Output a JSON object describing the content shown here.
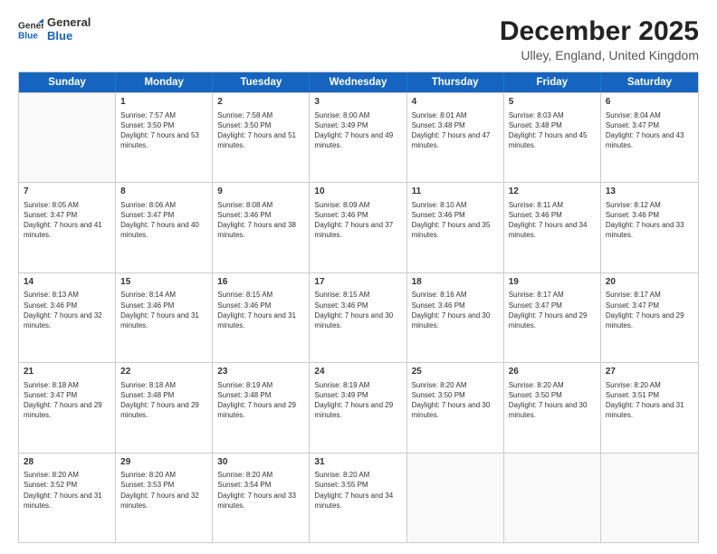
{
  "logo": {
    "line1": "General",
    "line2": "Blue"
  },
  "title": "December 2025",
  "subtitle": "Ulley, England, United Kingdom",
  "days_of_week": [
    "Sunday",
    "Monday",
    "Tuesday",
    "Wednesday",
    "Thursday",
    "Friday",
    "Saturday"
  ],
  "weeks": [
    [
      {
        "day": "",
        "sunrise": "",
        "sunset": "",
        "daylight": "",
        "empty": true
      },
      {
        "day": "1",
        "sunrise": "Sunrise: 7:57 AM",
        "sunset": "Sunset: 3:50 PM",
        "daylight": "Daylight: 7 hours and 53 minutes."
      },
      {
        "day": "2",
        "sunrise": "Sunrise: 7:58 AM",
        "sunset": "Sunset: 3:50 PM",
        "daylight": "Daylight: 7 hours and 51 minutes."
      },
      {
        "day": "3",
        "sunrise": "Sunrise: 8:00 AM",
        "sunset": "Sunset: 3:49 PM",
        "daylight": "Daylight: 7 hours and 49 minutes."
      },
      {
        "day": "4",
        "sunrise": "Sunrise: 8:01 AM",
        "sunset": "Sunset: 3:48 PM",
        "daylight": "Daylight: 7 hours and 47 minutes."
      },
      {
        "day": "5",
        "sunrise": "Sunrise: 8:03 AM",
        "sunset": "Sunset: 3:48 PM",
        "daylight": "Daylight: 7 hours and 45 minutes."
      },
      {
        "day": "6",
        "sunrise": "Sunrise: 8:04 AM",
        "sunset": "Sunset: 3:47 PM",
        "daylight": "Daylight: 7 hours and 43 minutes."
      }
    ],
    [
      {
        "day": "7",
        "sunrise": "Sunrise: 8:05 AM",
        "sunset": "Sunset: 3:47 PM",
        "daylight": "Daylight: 7 hours and 41 minutes."
      },
      {
        "day": "8",
        "sunrise": "Sunrise: 8:06 AM",
        "sunset": "Sunset: 3:47 PM",
        "daylight": "Daylight: 7 hours and 40 minutes."
      },
      {
        "day": "9",
        "sunrise": "Sunrise: 8:08 AM",
        "sunset": "Sunset: 3:46 PM",
        "daylight": "Daylight: 7 hours and 38 minutes."
      },
      {
        "day": "10",
        "sunrise": "Sunrise: 8:09 AM",
        "sunset": "Sunset: 3:46 PM",
        "daylight": "Daylight: 7 hours and 37 minutes."
      },
      {
        "day": "11",
        "sunrise": "Sunrise: 8:10 AM",
        "sunset": "Sunset: 3:46 PM",
        "daylight": "Daylight: 7 hours and 35 minutes."
      },
      {
        "day": "12",
        "sunrise": "Sunrise: 8:11 AM",
        "sunset": "Sunset: 3:46 PM",
        "daylight": "Daylight: 7 hours and 34 minutes."
      },
      {
        "day": "13",
        "sunrise": "Sunrise: 8:12 AM",
        "sunset": "Sunset: 3:46 PM",
        "daylight": "Daylight: 7 hours and 33 minutes."
      }
    ],
    [
      {
        "day": "14",
        "sunrise": "Sunrise: 8:13 AM",
        "sunset": "Sunset: 3:46 PM",
        "daylight": "Daylight: 7 hours and 32 minutes."
      },
      {
        "day": "15",
        "sunrise": "Sunrise: 8:14 AM",
        "sunset": "Sunset: 3:46 PM",
        "daylight": "Daylight: 7 hours and 31 minutes."
      },
      {
        "day": "16",
        "sunrise": "Sunrise: 8:15 AM",
        "sunset": "Sunset: 3:46 PM",
        "daylight": "Daylight: 7 hours and 31 minutes."
      },
      {
        "day": "17",
        "sunrise": "Sunrise: 8:15 AM",
        "sunset": "Sunset: 3:46 PM",
        "daylight": "Daylight: 7 hours and 30 minutes."
      },
      {
        "day": "18",
        "sunrise": "Sunrise: 8:16 AM",
        "sunset": "Sunset: 3:46 PM",
        "daylight": "Daylight: 7 hours and 30 minutes."
      },
      {
        "day": "19",
        "sunrise": "Sunrise: 8:17 AM",
        "sunset": "Sunset: 3:47 PM",
        "daylight": "Daylight: 7 hours and 29 minutes."
      },
      {
        "day": "20",
        "sunrise": "Sunrise: 8:17 AM",
        "sunset": "Sunset: 3:47 PM",
        "daylight": "Daylight: 7 hours and 29 minutes."
      }
    ],
    [
      {
        "day": "21",
        "sunrise": "Sunrise: 8:18 AM",
        "sunset": "Sunset: 3:47 PM",
        "daylight": "Daylight: 7 hours and 29 minutes."
      },
      {
        "day": "22",
        "sunrise": "Sunrise: 8:18 AM",
        "sunset": "Sunset: 3:48 PM",
        "daylight": "Daylight: 7 hours and 29 minutes."
      },
      {
        "day": "23",
        "sunrise": "Sunrise: 8:19 AM",
        "sunset": "Sunset: 3:48 PM",
        "daylight": "Daylight: 7 hours and 29 minutes."
      },
      {
        "day": "24",
        "sunrise": "Sunrise: 8:19 AM",
        "sunset": "Sunset: 3:49 PM",
        "daylight": "Daylight: 7 hours and 29 minutes."
      },
      {
        "day": "25",
        "sunrise": "Sunrise: 8:20 AM",
        "sunset": "Sunset: 3:50 PM",
        "daylight": "Daylight: 7 hours and 30 minutes."
      },
      {
        "day": "26",
        "sunrise": "Sunrise: 8:20 AM",
        "sunset": "Sunset: 3:50 PM",
        "daylight": "Daylight: 7 hours and 30 minutes."
      },
      {
        "day": "27",
        "sunrise": "Sunrise: 8:20 AM",
        "sunset": "Sunset: 3:51 PM",
        "daylight": "Daylight: 7 hours and 31 minutes."
      }
    ],
    [
      {
        "day": "28",
        "sunrise": "Sunrise: 8:20 AM",
        "sunset": "Sunset: 3:52 PM",
        "daylight": "Daylight: 7 hours and 31 minutes."
      },
      {
        "day": "29",
        "sunrise": "Sunrise: 8:20 AM",
        "sunset": "Sunset: 3:53 PM",
        "daylight": "Daylight: 7 hours and 32 minutes."
      },
      {
        "day": "30",
        "sunrise": "Sunrise: 8:20 AM",
        "sunset": "Sunset: 3:54 PM",
        "daylight": "Daylight: 7 hours and 33 minutes."
      },
      {
        "day": "31",
        "sunrise": "Sunrise: 8:20 AM",
        "sunset": "Sunset: 3:55 PM",
        "daylight": "Daylight: 7 hours and 34 minutes."
      },
      {
        "day": "",
        "sunrise": "",
        "sunset": "",
        "daylight": "",
        "empty": true
      },
      {
        "day": "",
        "sunrise": "",
        "sunset": "",
        "daylight": "",
        "empty": true
      },
      {
        "day": "",
        "sunrise": "",
        "sunset": "",
        "daylight": "",
        "empty": true
      }
    ]
  ]
}
